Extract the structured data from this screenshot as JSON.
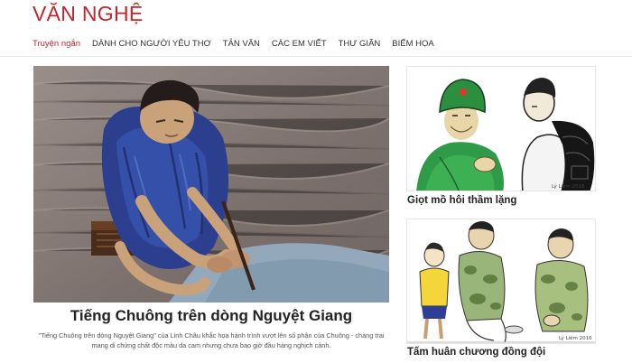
{
  "section": {
    "title": "VĂN NGHỆ"
  },
  "nav": {
    "items": [
      {
        "label": "Truyện ngắn",
        "active": true
      },
      {
        "label": "DÀNH CHO NGƯỜI YÊU THƠ",
        "active": false
      },
      {
        "label": "TẢN VĂN",
        "active": false
      },
      {
        "label": "CÁC EM VIẾT",
        "active": false
      },
      {
        "label": "THƯ GIÃN",
        "active": false
      },
      {
        "label": "BIẾM HỌA",
        "active": false
      }
    ]
  },
  "main_article": {
    "title": "Tiếng Chuông trên dòng Nguyệt Giang",
    "description": "\"Tiếng Chuông trên dòng Nguyệt Giang\" của Linh Châu khắc họa hành trình vượt lên số phận của Chuông - chàng trai mang di chứng chất độc màu da cam nhưng chưa bao giờ đầu hàng nghịch cảnh."
  },
  "side_articles": [
    {
      "title": "Giọt mồ hôi thầm lặng",
      "signature": "Lý Liêm 2016"
    },
    {
      "title": "Tấm huân chương đồng đội",
      "signature": "Lý Liêm 2016"
    }
  ],
  "colors": {
    "accent": "#c0272d",
    "text": "#222222",
    "muted": "#555555"
  }
}
